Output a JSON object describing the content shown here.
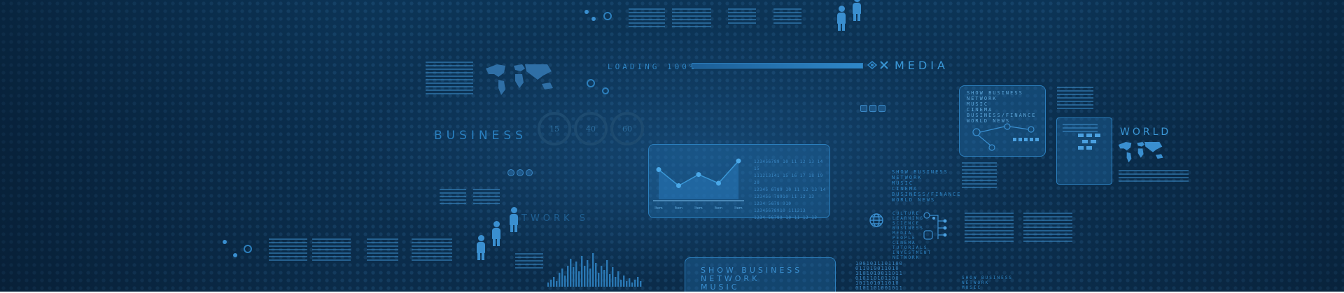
{
  "banner": {
    "business": "BUSINESS",
    "loading": "LOADING 100%",
    "loading_progress": 1.0,
    "media": "MEDIA",
    "world": "WORLD",
    "network": "TWORK S",
    "rings": [
      "15",
      "40",
      "60"
    ],
    "chart_rows": [
      "123456789 10 11 12 13 14 15",
      "111213141 15 16 17 18 19 20",
      "12345 6789 10 11 12 13 14",
      "123456 78910 11 12 13",
      "1234 5678 910",
      "12345678910 111213",
      "1234 56789 10 11 12 13"
    ],
    "chart_xlabels": [
      "Item",
      "Item",
      "Item",
      "Item",
      "Item"
    ],
    "chart_values": [
      48,
      22,
      40,
      26,
      62
    ],
    "right_panel_items": [
      "SHOW BUSINESS",
      "NETWORK",
      "MUSIC",
      "CINEMA",
      "BUSINESS/FINANCE",
      "WORLD NEWS"
    ],
    "mid_list_items": [
      "SHOW BUSINESS",
      "NETWORK",
      "MUSIC",
      "CINEMA",
      "BUSINESS/FINANCE",
      "WORLD NEWS"
    ],
    "bottom_panel_items": [
      "SHOW BUSINESS",
      "NETWORK",
      "MUSIC"
    ],
    "lower_list_items": [
      "CULTURE",
      "LEARNING",
      "SCIENCE",
      "BUSINESS",
      "MEDIA",
      "PEOPLE",
      "CINEMA",
      "TUTORIALS",
      "INVESTMENT",
      "NETWORK"
    ],
    "bottom_right_items": [
      "SHOW BUSINESS",
      "NETWORK",
      "MUSIC"
    ],
    "binary_rows": [
      "1001011101100",
      "011010011010",
      "1101010011011",
      "010110101100",
      "101101011010",
      "0101101001011"
    ]
  }
}
